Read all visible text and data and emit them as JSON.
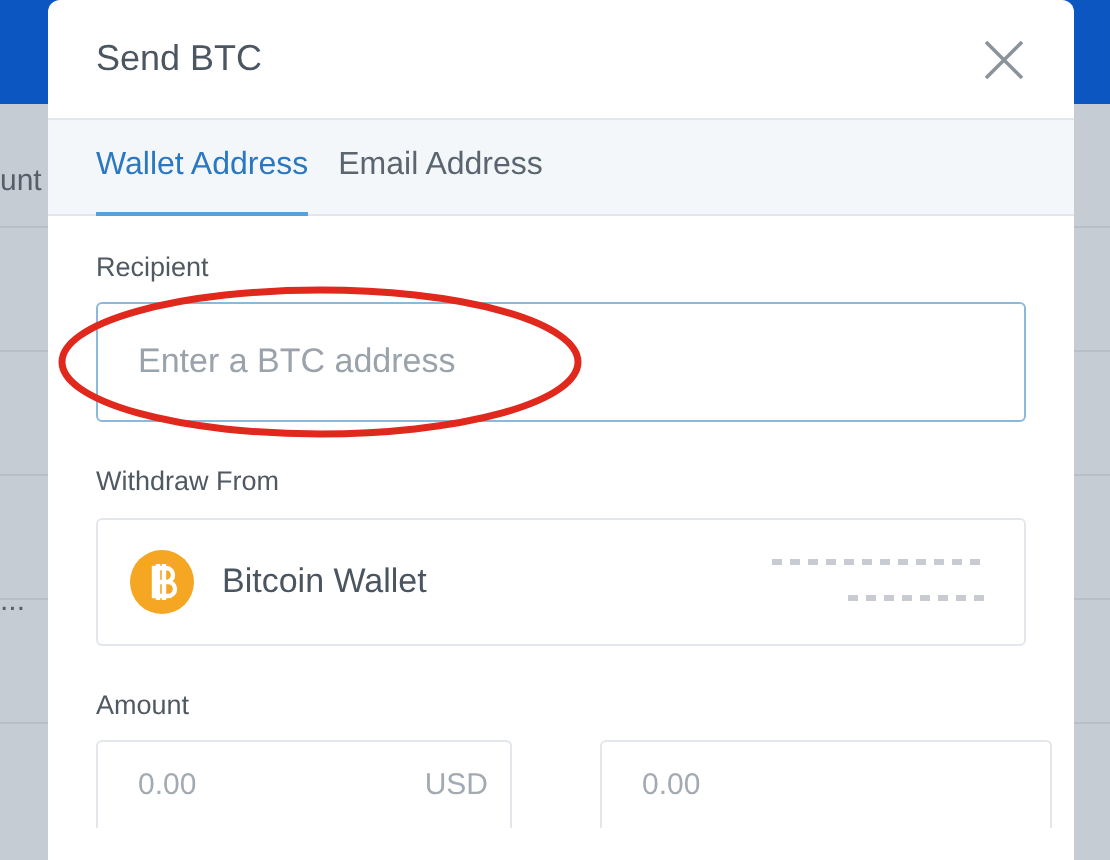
{
  "background": {
    "texts": [
      {
        "text": "unt"
      },
      {
        "text": "..."
      }
    ]
  },
  "modal": {
    "title": "Send BTC",
    "tabs": [
      {
        "label": "Wallet Address",
        "selected": true
      },
      {
        "label": "Email Address",
        "selected": false
      }
    ],
    "recipient": {
      "label": "Recipient",
      "placeholder": "Enter a BTC address",
      "highlighted": true
    },
    "withdraw_from": {
      "label": "Withdraw From",
      "wallet": "Bitcoin Wallet"
    },
    "amount": {
      "label": "Amount",
      "fiat": {
        "placeholder": "0.00",
        "currency": "USD"
      },
      "crypto": {
        "placeholder": "0.00"
      }
    }
  }
}
